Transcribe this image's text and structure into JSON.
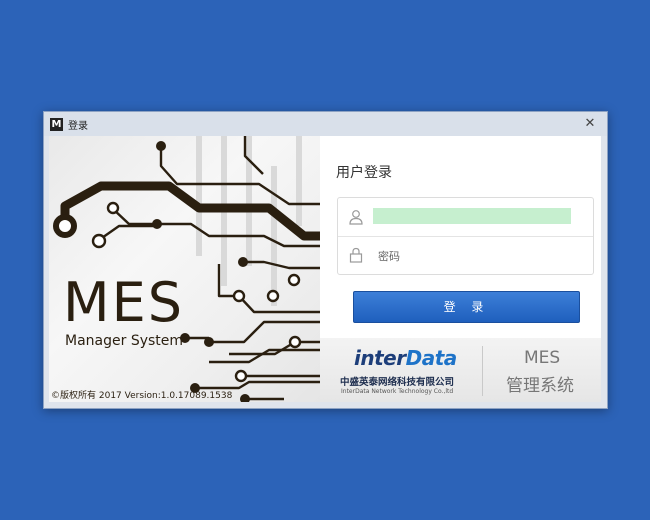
{
  "window": {
    "title": "登录",
    "app_icon_letter": "M",
    "close_symbol": "✕"
  },
  "left": {
    "logo_title": "MES",
    "logo_subtitle": "Manager System",
    "copyright": "©版权所有  2017 Version:1.0.17089.1538"
  },
  "login": {
    "title": "用户登录",
    "username_value": "",
    "password_placeholder": "密码",
    "submit_label": "登 录"
  },
  "footer": {
    "brand_part1": "inter",
    "brand_part2": "Data",
    "company_cn": "中盛英泰网络科技有限公司",
    "company_en": "InterData Network Technology Co.,ltd",
    "product_line1": "MES",
    "product_line2": "管理系统"
  },
  "colors": {
    "desktop": "#2c63b8",
    "button": "#1f5fbd",
    "autofill": "#c6efcf",
    "brand_blue": "#1e73c8"
  },
  "icons": [
    "user-icon",
    "lock-icon",
    "close-icon",
    "app-icon"
  ]
}
